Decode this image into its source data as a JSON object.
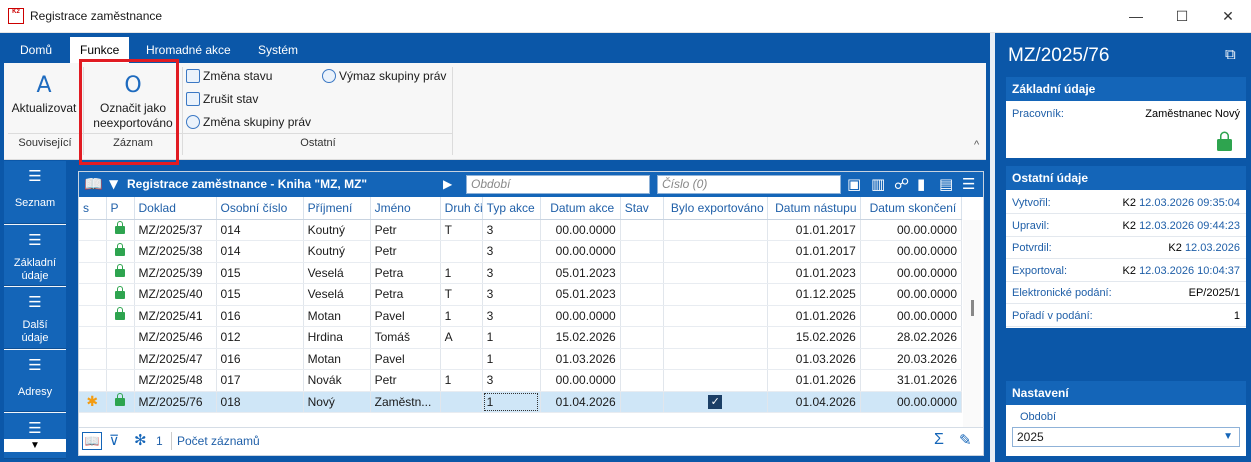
{
  "window": {
    "title": "Registrace zaměstnance",
    "icon_text": "K2",
    "minimize": "—",
    "maximize": "☐",
    "close": "✕"
  },
  "ribbon": {
    "tabs": [
      "Domů",
      "Funkce",
      "Hromadné akce",
      "Systém"
    ],
    "active_tab": "Funkce",
    "refresh": {
      "icon": "A",
      "label": "Aktualizovat"
    },
    "mark": {
      "icon": "O",
      "label1": "Označit jako",
      "label2": "neexportováno"
    },
    "small": [
      "Změna stavu",
      "Zrušit stav",
      "Změna skupiny práv",
      "Výmaz skupiny práv"
    ],
    "groups": [
      "Související",
      "Záznam",
      "Ostatní"
    ],
    "collapse": "^"
  },
  "nav": [
    "Seznam",
    "Základní údaje",
    "Další údaje",
    "Adresy"
  ],
  "grid": {
    "title": "Registrace zaměstnance - Kniha \"MZ, MZ\"",
    "period_placeholder": "Období",
    "number_placeholder": "Číslo (0)",
    "columns": [
      "s",
      "P",
      "Doklad",
      "Osobní číslo",
      "Příjmení",
      "Jméno",
      "Druh či",
      "Typ akce",
      "Datum akce",
      "Stav",
      "Bylo exportováno",
      "Datum nástupu",
      "Datum skončení"
    ],
    "rows": [
      {
        "s": "",
        "p": true,
        "doklad": "MZ/2025/37",
        "oc": "014",
        "prijmeni": "Koutný",
        "jmeno": "Petr",
        "druh": "T",
        "typ": "3",
        "datum_akce": "00.00.0000",
        "stav": "",
        "export": false,
        "nastup": "01.01.2017",
        "skonceni": "00.00.0000"
      },
      {
        "s": "",
        "p": true,
        "doklad": "MZ/2025/38",
        "oc": "014",
        "prijmeni": "Koutný",
        "jmeno": "Petr",
        "druh": "",
        "typ": "3",
        "datum_akce": "00.00.0000",
        "stav": "",
        "export": false,
        "nastup": "01.01.2017",
        "skonceni": "00.00.0000"
      },
      {
        "s": "",
        "p": true,
        "doklad": "MZ/2025/39",
        "oc": "015",
        "prijmeni": "Veselá",
        "jmeno": "Petra",
        "druh": "1",
        "typ": "3",
        "datum_akce": "05.01.2023",
        "stav": "",
        "export": false,
        "nastup": "01.01.2023",
        "skonceni": "00.00.0000"
      },
      {
        "s": "",
        "p": true,
        "doklad": "MZ/2025/40",
        "oc": "015",
        "prijmeni": "Veselá",
        "jmeno": "Petra",
        "druh": "T",
        "typ": "3",
        "datum_akce": "05.01.2023",
        "stav": "",
        "export": false,
        "nastup": "01.12.2025",
        "skonceni": "00.00.0000"
      },
      {
        "s": "",
        "p": true,
        "doklad": "MZ/2025/41",
        "oc": "016",
        "prijmeni": "Motan",
        "jmeno": "Pavel",
        "druh": "1",
        "typ": "3",
        "datum_akce": "00.00.0000",
        "stav": "",
        "export": false,
        "nastup": "01.01.2026",
        "skonceni": "00.00.0000"
      },
      {
        "s": "",
        "p": false,
        "doklad": "MZ/2025/46",
        "oc": "012",
        "prijmeni": "Hrdina",
        "jmeno": "Tomáš",
        "druh": "A",
        "typ": "1",
        "datum_akce": "15.02.2026",
        "stav": "",
        "export": false,
        "nastup": "15.02.2026",
        "skonceni": "28.02.2026"
      },
      {
        "s": "",
        "p": false,
        "doklad": "MZ/2025/47",
        "oc": "016",
        "prijmeni": "Motan",
        "jmeno": "Pavel",
        "druh": "",
        "typ": "1",
        "datum_akce": "01.03.2026",
        "stav": "",
        "export": false,
        "nastup": "01.03.2026",
        "skonceni": "20.03.2026"
      },
      {
        "s": "",
        "p": false,
        "doklad": "MZ/2025/48",
        "oc": "017",
        "prijmeni": "Novák",
        "jmeno": "Petr",
        "druh": "1",
        "typ": "3",
        "datum_akce": "00.00.0000",
        "stav": "",
        "export": false,
        "nastup": "01.01.2026",
        "skonceni": "31.01.2026"
      },
      {
        "s": "✱",
        "p": true,
        "doklad": "MZ/2025/76",
        "oc": "018",
        "prijmeni": "Nový",
        "jmeno": "Zaměstn...",
        "druh": "",
        "typ": "1",
        "datum_akce": "01.04.2026",
        "stav": "",
        "export": true,
        "nastup": "01.04.2026",
        "skonceni": "00.00.0000"
      }
    ],
    "footer_count": "1",
    "footer_label": "Počet záznamů"
  },
  "right": {
    "doc_title": "MZ/2025/76",
    "basic_header": "Základní údaje",
    "worker_label": "Pracovník:",
    "worker_value": "Zaměstnanec Nový",
    "other_header": "Ostatní údaje",
    "other": [
      {
        "label": "Vytvořil:",
        "user": "K2",
        "date": "12.03.2026 09:35:04"
      },
      {
        "label": "Upravil:",
        "user": "K2",
        "date": "12.03.2026 09:44:23"
      },
      {
        "label": "Potvrdil:",
        "user": "K2",
        "date": "12.03.2026"
      },
      {
        "label": "Exportoval:",
        "user": "K2",
        "date": "12.03.2026 10:04:37"
      },
      {
        "label": "Elektronické podání:",
        "user": "EP/2025/1",
        "date": ""
      },
      {
        "label": "Pořadí v podání:",
        "user": "1",
        "date": ""
      }
    ],
    "settings_header": "Nastavení",
    "period_label": "Období",
    "period_value": "2025"
  }
}
